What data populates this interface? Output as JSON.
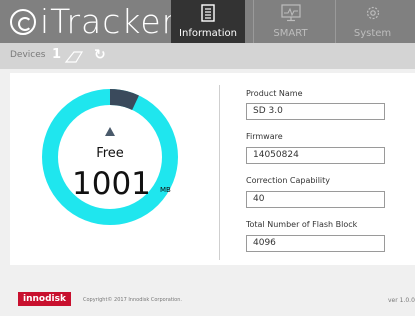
{
  "app": {
    "logo_text": "iTracker"
  },
  "tabs": [
    {
      "label": "Information",
      "active": true
    },
    {
      "label": "SMART",
      "active": false
    },
    {
      "label": "System",
      "active": false
    }
  ],
  "toolbar": {
    "devices_label": "Devices",
    "device_count": "1"
  },
  "gauge": {
    "free_label": "Free",
    "free_value": "1001",
    "unit": "MB",
    "used_fraction": 0.07,
    "colors": {
      "free": "#1fe6ee",
      "used": "#3a4a5c"
    }
  },
  "fields": [
    {
      "label": "Product Name",
      "value": "SD 3.0"
    },
    {
      "label": "Firmware",
      "value": "14050824"
    },
    {
      "label": "Correction Capability",
      "value": "40"
    },
    {
      "label": "Total Number of Flash Block",
      "value": "4096"
    }
  ],
  "footer": {
    "brand": "innodisk",
    "copyright": "Copyright© 2017 Innodisk Corporation.",
    "version": "ver 1.0.0"
  }
}
